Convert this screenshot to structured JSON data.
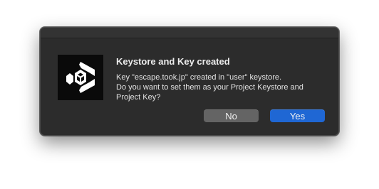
{
  "dialog": {
    "title": "Keystore and Key created",
    "message_lines": [
      "Key \"escape.took.jp\" created in \"user\" keystore.",
      "Do you want to set them as your Project Keystore and",
      "Project Key?"
    ],
    "buttons": {
      "no_label": "No",
      "yes_label": "Yes"
    },
    "icon": "unity-logo-icon"
  },
  "colors": {
    "dialog_background": "#2c2c2c",
    "default_button": "#1f67d4",
    "secondary_button": "#646464",
    "icon_background": "#0a0a0a"
  }
}
